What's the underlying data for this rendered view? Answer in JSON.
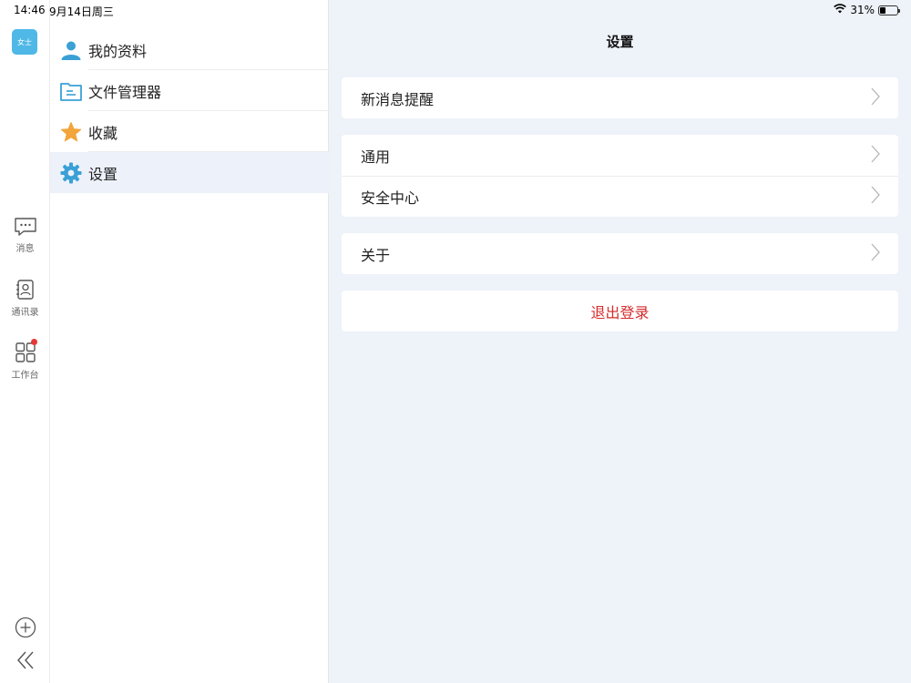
{
  "status_bar": {
    "time": "14:46",
    "date": "9月14日周三",
    "battery": "31%",
    "battery_level": 0.31
  },
  "rail": {
    "avatar_text": "女士",
    "items": [
      {
        "label": "消息",
        "icon": "chat-bubble-icon"
      },
      {
        "label": "通讯录",
        "icon": "contacts-icon"
      },
      {
        "label": "工作台",
        "icon": "grid-apps-icon",
        "badge": true
      }
    ]
  },
  "menu": {
    "items": [
      {
        "label": "我的资料",
        "icon": "person-icon"
      },
      {
        "label": "文件管理器",
        "icon": "folder-icon"
      },
      {
        "label": "收藏",
        "icon": "star-icon"
      },
      {
        "label": "设置",
        "icon": "gear-icon",
        "active": true
      }
    ]
  },
  "detail": {
    "title": "设置",
    "groups": [
      [
        {
          "label": "新消息提醒"
        }
      ],
      [
        {
          "label": "通用"
        },
        {
          "label": "安全中心"
        }
      ],
      [
        {
          "label": "关于"
        }
      ]
    ],
    "logout_label": "退出登录"
  },
  "colors": {
    "accent_blue": "#3aa0d6",
    "logout_red": "#d62b2b",
    "panel_bg": "#eef2f9",
    "star": "#f2a53a"
  }
}
